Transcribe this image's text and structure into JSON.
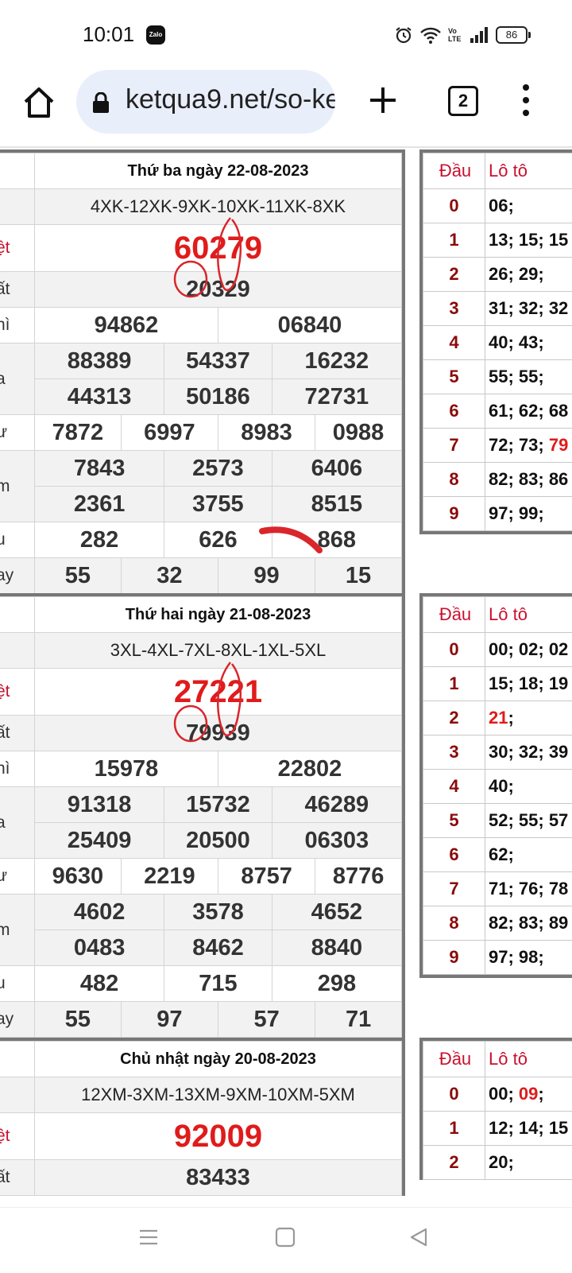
{
  "status": {
    "time": "10:01",
    "zalo": "Zalo",
    "battery": "86",
    "volte": "Vo LTE"
  },
  "browser": {
    "url": "ketqua9.net/so-ke",
    "tab_count": "2"
  },
  "results": [
    {
      "date": "Thứ ba ngày 22-08-2023",
      "codes": "4XK-12XK-9XK-10XK-11XK-8XK",
      "labels": [
        "ệt",
        "ất",
        "hì",
        "a",
        "ư",
        "m",
        "u",
        "ay"
      ],
      "special": "60279",
      "first": "20329",
      "second": [
        "94862",
        "06840"
      ],
      "third": [
        "88389",
        "54337",
        "16232",
        "44313",
        "50186",
        "72731"
      ],
      "fourth": [
        "7872",
        "6997",
        "8983",
        "0988"
      ],
      "fifth": [
        "7843",
        "2573",
        "6406",
        "2361",
        "3755",
        "8515"
      ],
      "sixth": [
        "282",
        "626",
        "868"
      ],
      "seventh": [
        "55",
        "32",
        "99",
        "15"
      ]
    },
    {
      "date": "Thứ hai ngày 21-08-2023",
      "codes": "3XL-4XL-7XL-8XL-1XL-5XL",
      "labels": [
        "ệt",
        "ất",
        "hì",
        "a",
        "ư",
        "m",
        "u",
        "ay"
      ],
      "special": "27221",
      "first": "79939",
      "second": [
        "15978",
        "22802"
      ],
      "third": [
        "91318",
        "15732",
        "46289",
        "25409",
        "20500",
        "06303"
      ],
      "fourth": [
        "9630",
        "2219",
        "8757",
        "8776"
      ],
      "fifth": [
        "4602",
        "3578",
        "4652",
        "0483",
        "8462",
        "8840"
      ],
      "sixth": [
        "482",
        "715",
        "298"
      ],
      "seventh": [
        "55",
        "97",
        "57",
        "71"
      ]
    },
    {
      "date": "Chủ nhật ngày 20-08-2023",
      "codes": "12XM-3XM-13XM-9XM-10XM-5XM",
      "labels": [
        "ệt",
        "ất"
      ],
      "special": "92009",
      "first": "83433"
    }
  ],
  "loto": [
    {
      "header": [
        "Đầu",
        "Lô tô"
      ],
      "rows": [
        {
          "head": "0",
          "tail": "06;"
        },
        {
          "head": "1",
          "tail": "13; 15; 15"
        },
        {
          "head": "2",
          "tail": "26; 29;"
        },
        {
          "head": "3",
          "tail": "31; 32; 32"
        },
        {
          "head": "4",
          "tail": "40; 43;"
        },
        {
          "head": "5",
          "tail": "55; 55;"
        },
        {
          "head": "6",
          "tail": "61; 62; 68"
        },
        {
          "head": "7",
          "tail": "72; 73; ",
          "highlight": "79"
        },
        {
          "head": "8",
          "tail": "82; 83; 86"
        },
        {
          "head": "9",
          "tail": "97; 99;"
        }
      ]
    },
    {
      "header": [
        "Đầu",
        "Lô tô"
      ],
      "rows": [
        {
          "head": "0",
          "tail": "00; 02; 02"
        },
        {
          "head": "1",
          "tail": "15; 18; 19"
        },
        {
          "head": "2",
          "tail": "",
          "highlight": "21",
          "after": ";"
        },
        {
          "head": "3",
          "tail": "30; 32; 39"
        },
        {
          "head": "4",
          "tail": "40;"
        },
        {
          "head": "5",
          "tail": "52; 55; 57"
        },
        {
          "head": "6",
          "tail": "62;"
        },
        {
          "head": "7",
          "tail": "71; 76; 78"
        },
        {
          "head": "8",
          "tail": "82; 83; 89"
        },
        {
          "head": "9",
          "tail": "97; 98;"
        }
      ]
    },
    {
      "header": [
        "Đầu",
        "Lô tô"
      ],
      "rows": [
        {
          "head": "0",
          "tail": "00; ",
          "highlight": "09",
          "after": ";"
        },
        {
          "head": "1",
          "tail": "12; 14; 15"
        },
        {
          "head": "2",
          "tail": "20;"
        }
      ]
    }
  ]
}
